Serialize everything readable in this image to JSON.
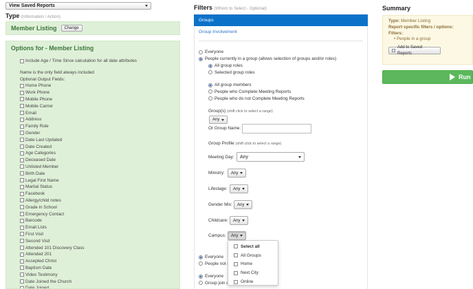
{
  "saved_reports": {
    "value": "View Saved Reports"
  },
  "type": {
    "heading": "Type",
    "subheading": "(Information / Action)"
  },
  "member_listing": {
    "title": "Member Listing",
    "change_label": "Change"
  },
  "options": {
    "title": "Options for - Member Listing",
    "include_age_label": "Include Age / Time Since calculation for all date attributes",
    "note1": "Name is the only field always included",
    "note2": "Optional Output Fields:",
    "fields": [
      "Home Phone",
      "Work Phone",
      "Mobile Phone",
      "Mobile Carrier",
      "Email",
      "Address",
      "Family Role",
      "Gender",
      "Date Last Updated",
      "Date Created",
      "Age Categories",
      "Deceased Date",
      "Unlisted Member",
      "Birth Date",
      "Legal First Name",
      "Marital Status",
      "Facebook",
      "Allergy/child notes",
      "Grade in School",
      "Emergency Contact",
      "Barcode",
      "Email Lists",
      "First Visit",
      "Second Visit",
      "Attended 101 Discovery Class",
      "Attended 201",
      "Accepted Christ",
      "Baptism Date",
      "Video Testimony",
      "Date Joined the Church",
      "Date Joined"
    ]
  },
  "filters": {
    "heading": "Filters",
    "subheading": "(Whom to Select - Optional)",
    "groups_tab": "Groups",
    "group_involvement": "Group Involvement",
    "everyone": "Everyone",
    "people_in_group": "People currently in a group (allows selection of groups and/or roles)",
    "all_group_roles": "All group roles",
    "selected_group_roles": "Selected group roles",
    "all_group_members": "All group members",
    "meeting_complete": "People who Complete Meeting Reports",
    "meeting_not_complete": "People who do not Complete Meeting Reports",
    "groups_label": "Group(s)",
    "shift_hint": "(shift click to select a range)",
    "any": "Any",
    "or_group_name": "Or Group Name:",
    "group_name_value": "",
    "group_profile": "Group Profile",
    "meeting_day_label": "Meeting Day:",
    "ministry_label": "Ministry:",
    "lifestage_label": "Lifestage:",
    "gender_mix_label": "Gender Mix:",
    "childcare_label": "Childcare:",
    "campus_label": "Campus:",
    "everyone2": "Everyone",
    "people_not_prefix": "People not i",
    "everyone3": "Everyone",
    "group_join_prefix": "Group join d",
    "campus_menu": [
      "Select all",
      "All Groups",
      "Home",
      "Next City",
      "Online"
    ]
  },
  "summary": {
    "heading": "Summary",
    "type_label": "Type:",
    "type_value": "Member Listing",
    "specific": "Report specific filters / options:",
    "filters_label": "Filters:",
    "filter_item": "People in a group",
    "add_saved": "Add to Saved Reports",
    "run_label": "Run C"
  },
  "colors": {
    "green_panel": "#dff0d8",
    "blue_tab": "#0b72c9",
    "summary_bg": "#fcf8e3",
    "run_green": "#5cb85c"
  }
}
